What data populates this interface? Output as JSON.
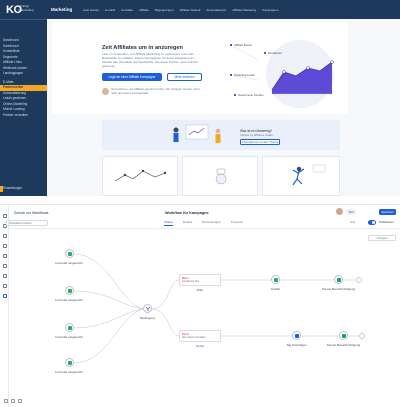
{
  "screen1": {
    "logo": "KO",
    "logo_sub": "Klicktipp Onboarding",
    "brand": "Marketing",
    "top_menu": [
      "Auto starten",
      "E-mails",
      "Kontakte",
      "Affiliate",
      "Begegnungen",
      "Affiliate Verkauf",
      "Automatisieren",
      "Affiliate-Marketing",
      "Kampagnen"
    ],
    "sidebar_items": [
      {
        "label": "Dashboard",
        "active": false
      },
      {
        "label": "Dashboard",
        "active": false
      },
      {
        "label": "Kontaktliste",
        "active": false
      },
      {
        "label": "Segmente",
        "active": false
      },
      {
        "label": "Affiliate Links",
        "active": false
      },
      {
        "label": "Webinare planen",
        "active": false
      },
      {
        "label": "Landingpages",
        "active": false
      },
      {
        "label": "",
        "active": false
      },
      {
        "label": "E-Mails",
        "active": false
      },
      {
        "label": "Partnerseiten",
        "active": true
      },
      {
        "label": "Automatisierung",
        "active": false
      },
      {
        "label": "Leads gewinnen",
        "active": false
      },
      {
        "label": "Online-Marketing",
        "active": false
      },
      {
        "label": "Mobile Landing",
        "active": false
      },
      {
        "label": "Partner verwalten",
        "active": false
      }
    ],
    "sidebar_footer": "Einstellungen",
    "hero": {
      "title": "Zeit Affiliates um in anzuregen",
      "text": "Lass zu verwenden, um Affiliate-Marketing zu verbessern und mehr Reichweite zu erhalten. Passe Kampagnen für deine Zielgruppe an, behalte den Überblick und beobachte, wie deine Partner neue Kunden gewinnen.",
      "primary_button": "Lege an einer Affiliate Kampagne",
      "secondary_button": "Mehr erfahren",
      "note": "Ich bestimme, wie Affiliates genutzt werden. Die Vorlagen werden sofort nach dem Setup bereitgestellt.",
      "chart_labels": [
        "Affiliate Bonus",
        "Marketing Leads",
        "Einnahmen",
        "Gewonnene Kunden"
      ]
    },
    "promo": {
      "title": "Was ist ein Marketing?",
      "text": "Vorteile zu Affiliates erklärt.",
      "button": "Informationen zu dem Thema"
    },
    "colors": {
      "sidebar": "#1d3a5c",
      "accent": "#f5a623",
      "primary": "#1e5fd8",
      "chart": "#5b4bd6"
    }
  },
  "screen2": {
    "back": "Zurück zur Workflows",
    "folder": "Workflow-Ordner",
    "title": "Workflow für Kampagne",
    "tabs": [
      {
        "label": "Ablauf",
        "active": true
      },
      {
        "label": "Details",
        "active": false
      },
      {
        "label": "Einstellungen",
        "active": false
      },
      {
        "label": "Protokoll",
        "active": false
      }
    ],
    "button_light": "Test",
    "button_primary": "Speichern",
    "toggle_left": "Aus",
    "toggle_right": "Publizieren",
    "template_button": "Vorlagen",
    "triggers": [
      "Formular eingereicht",
      "Formular eingereicht",
      "Formular eingereicht",
      "Formular eingereicht"
    ],
    "condition_label": "Bedingung",
    "branch_top": {
      "header": "Wenn",
      "text": "Kontakt hat Tag",
      "label": "Filter",
      "actions": [
        "E-Mail",
        "Interne Benachrichtigung"
      ]
    },
    "branch_bottom": {
      "header": "Sonst",
      "text": "Alle anderen Kontakte",
      "label": "Sonst",
      "actions": [
        "Tag hinzufügen",
        "Interne Benachrichtigung"
      ]
    },
    "colors": {
      "trigger": "#27ae60",
      "condition": "#8e44ad",
      "email": "#27ae60",
      "tag": "#1e5fd8",
      "notify": "#16a085"
    }
  }
}
